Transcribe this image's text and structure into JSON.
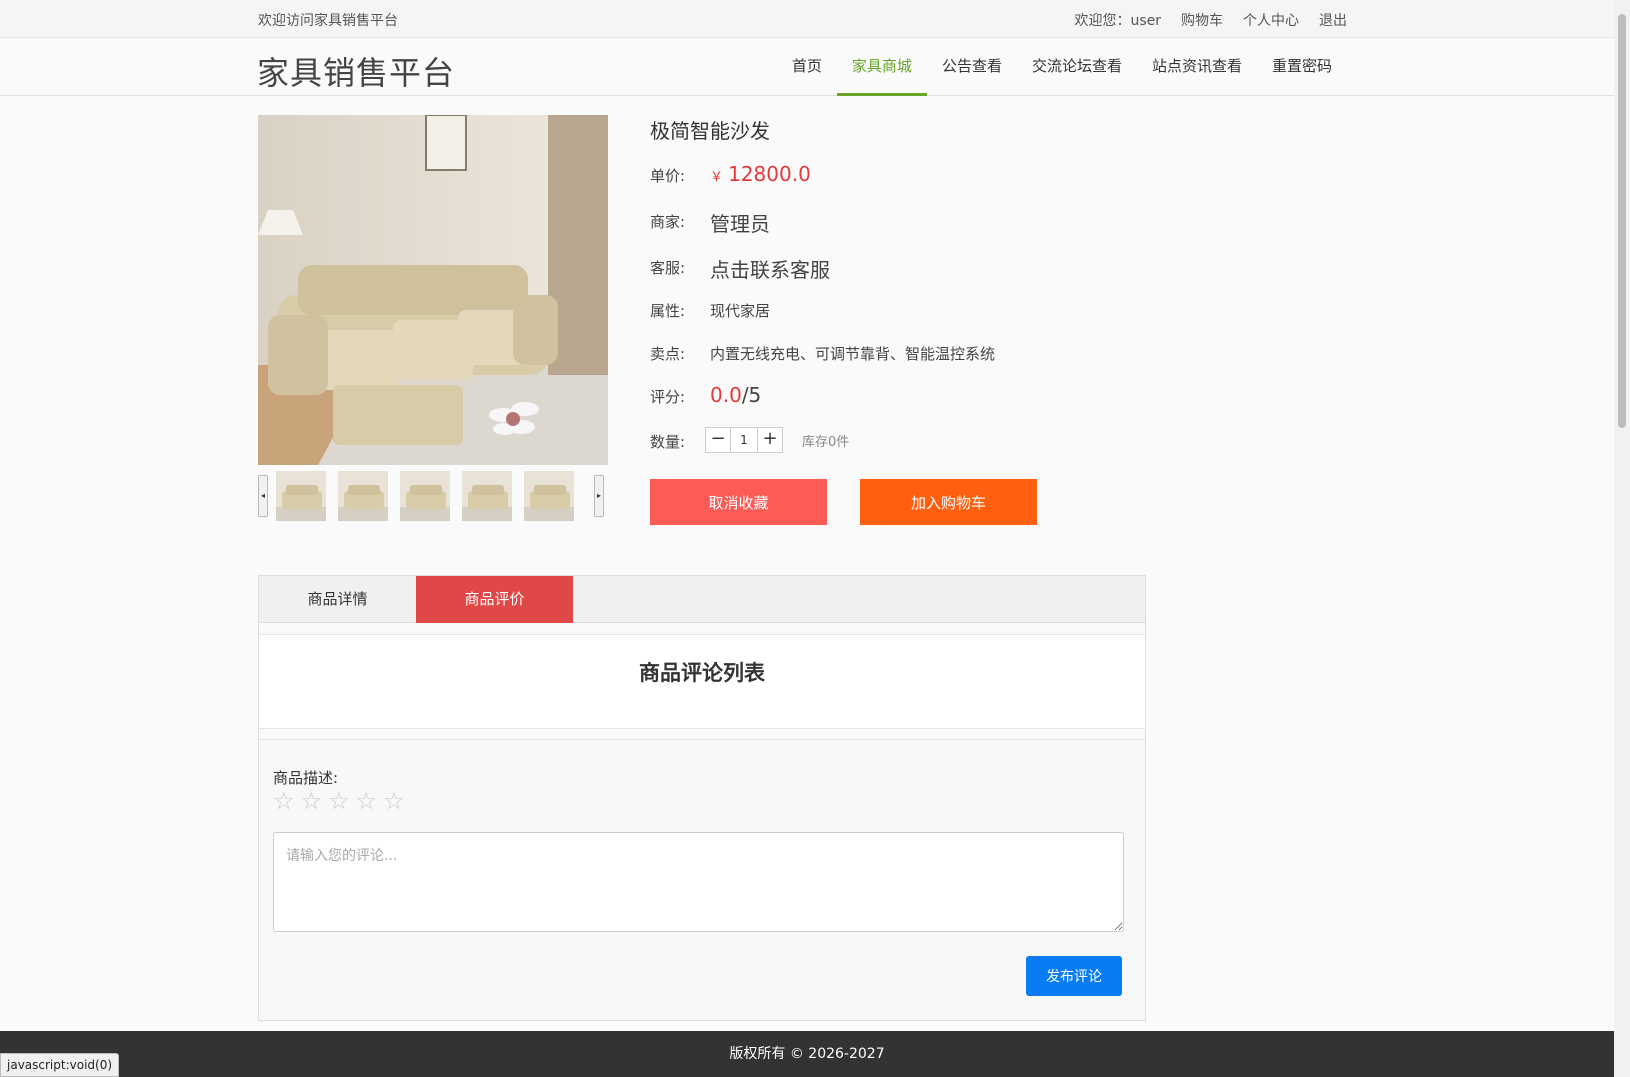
{
  "topbar": {
    "welcome": "欢迎访问家具销售平台",
    "user_greeting": "欢迎您：user",
    "cart": "购物车",
    "profile": "个人中心",
    "logout": "退出"
  },
  "header": {
    "logo": "家具销售平台",
    "nav": [
      "首页",
      "家具商城",
      "公告查看",
      "交流论坛查看",
      "站点资讯查看",
      "重置密码"
    ],
    "active_nav": "家具商城"
  },
  "product": {
    "title": "极简智能沙发",
    "price_label": "单价:",
    "price_symbol": "￥",
    "price": "12800.0",
    "merchant_label": "商家:",
    "merchant": "管理员",
    "service_label": "客服:",
    "service": "点击联系客服",
    "attr_label": "属性:",
    "attr": "现代家居",
    "selling_label": "卖点:",
    "selling": "内置无线充电、可调节靠背、智能温控系统",
    "rating_label": "评分:",
    "rating_value": "0.0",
    "rating_max": "/5",
    "qty_label": "数量:",
    "qty_minus": "−",
    "qty_plus": "+",
    "qty_value": "1",
    "stock": "库存0件",
    "cancel_fav": "取消收藏",
    "add_cart": "加入购物车"
  },
  "tabs": {
    "detail": "商品详情",
    "review": "商品评价",
    "active": "商品评价"
  },
  "comments": {
    "list_title": "商品评论列表",
    "desc_label": "商品描述:",
    "stars": [
      "☆",
      "☆",
      "☆",
      "☆",
      "☆"
    ],
    "rating": 0,
    "placeholder": "请输入您的评论...",
    "submit": "发布评论"
  },
  "footer": {
    "copyright": "版权所有 © 2026-2027"
  },
  "status_bar": "javascript:void(0)"
}
